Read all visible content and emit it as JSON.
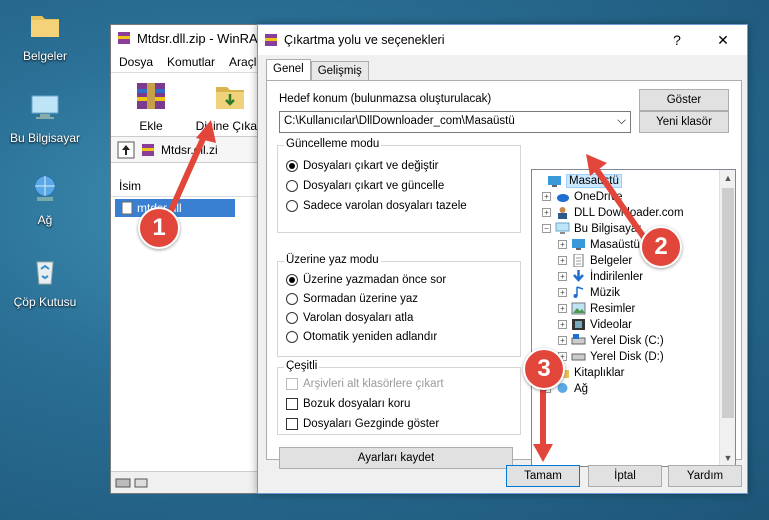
{
  "desktop": {
    "icons": [
      {
        "label": "Belgeler",
        "icon": "folder-icon"
      },
      {
        "label": "Bu Bilgisayar",
        "icon": "computer-icon"
      },
      {
        "label": "Ağ",
        "icon": "network-icon"
      },
      {
        "label": "Çöp Kutusu",
        "icon": "recycle-bin-icon"
      }
    ]
  },
  "winrar": {
    "title": "Mtdsr.dll.zip - WinRA",
    "menu": [
      "Dosya",
      "Komutlar",
      "Araçla"
    ],
    "toolbar": {
      "add_label": "Ekle",
      "extract_label": "Dizine Çıkart"
    },
    "path": "Mtdsr.dll.zi",
    "column_name": "İsim",
    "file": "mtdsr.dll"
  },
  "dialog": {
    "title": "Çıkartma yolu ve seçenekleri",
    "help_glyph": "?",
    "close_glyph": "✕",
    "tabs": [
      "Genel",
      "Gelişmiş"
    ],
    "target_label": "Hedef konum (bulunmazsa oluşturulacak)",
    "target_value": "C:\\Kullanıcılar\\DllDownloader_com\\Masaüstü",
    "show_button": "Göster",
    "new_folder_button": "Yeni klasör",
    "update_mode": {
      "title": "Güncelleme modu",
      "options": [
        "Dosyaları çıkart ve değiştir",
        "Dosyaları çıkart ve güncelle",
        "Sadece varolan dosyaları tazele"
      ],
      "selected": 0
    },
    "overwrite_mode": {
      "title": "Üzerine yaz modu",
      "options": [
        "Üzerine yazmadan önce sor",
        "Sormadan üzerine yaz",
        "Varolan dosyaları atla",
        "Otomatik yeniden adlandır"
      ],
      "selected": 0
    },
    "misc": {
      "title": "Çeşitli",
      "options": [
        "Arşivleri alt klasörlere çıkart",
        "Bozuk dosyaları koru",
        "Dosyaları Gezginde göster"
      ]
    },
    "save_settings_button": "Ayarları kaydet",
    "tree": [
      {
        "label": "Masaüstü",
        "icon": "desktop-icon",
        "selected": true
      },
      {
        "label": "OneDrive",
        "icon": "cloud-icon"
      },
      {
        "label": "DLL Downloader.com",
        "icon": "user-icon"
      },
      {
        "label": "Bu Bilgisayar",
        "icon": "computer-icon"
      },
      {
        "label": "Masaüstü",
        "icon": "desktop-icon"
      },
      {
        "label": "Belgeler",
        "icon": "document-icon"
      },
      {
        "label": "İndirilenler",
        "icon": "download-icon"
      },
      {
        "label": "Müzik",
        "icon": "music-icon"
      },
      {
        "label": "Resimler",
        "icon": "picture-icon"
      },
      {
        "label": "Videolar",
        "icon": "video-icon"
      },
      {
        "label": "Yerel Disk (C:)",
        "icon": "drive-icon"
      },
      {
        "label": "Yerel Disk (D:)",
        "icon": "drive-icon"
      },
      {
        "label": "Kitaplıklar",
        "icon": "library-icon"
      },
      {
        "label": "Ağ",
        "icon": "network-icon"
      }
    ],
    "ok_button": "Tamam",
    "cancel_button": "İptal",
    "help_button": "Yardım"
  },
  "annotations": {
    "step1": "1",
    "step2": "2",
    "step3": "3"
  },
  "colors": {
    "annotation_red": "#e2463a",
    "selection_blue": "#3a80d2"
  }
}
